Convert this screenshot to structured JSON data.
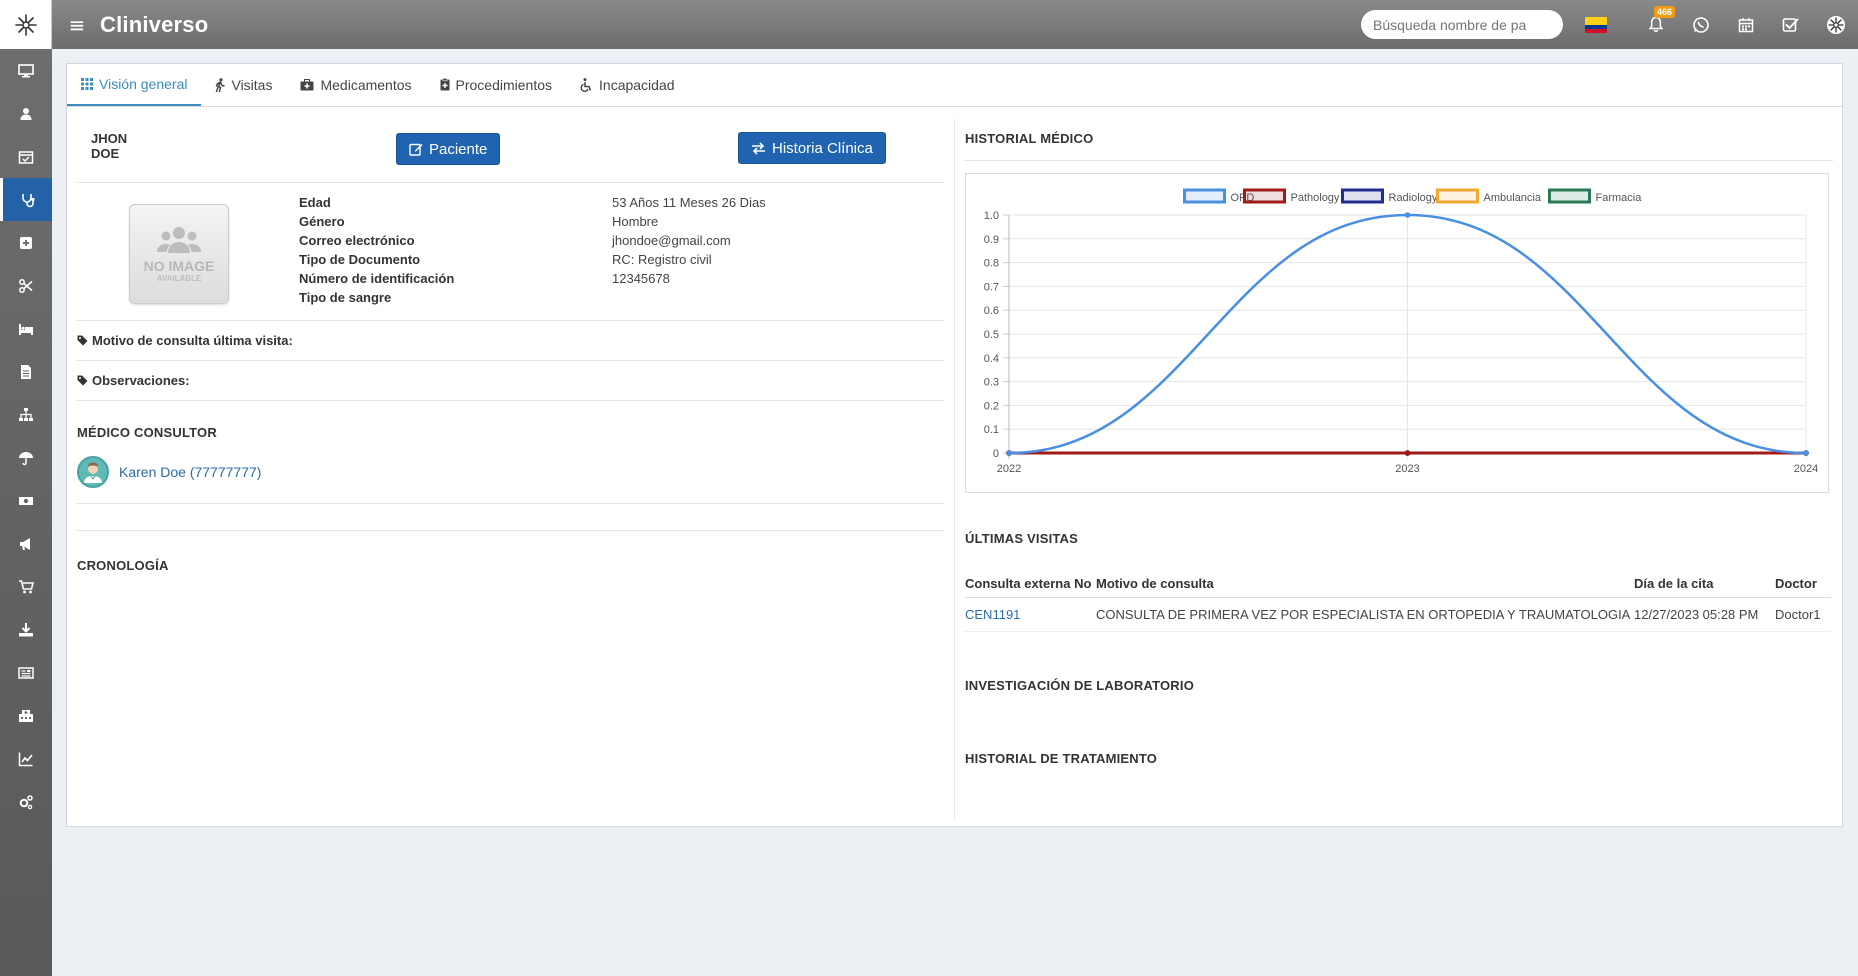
{
  "app": {
    "title": "Cliniverso"
  },
  "topbar": {
    "search_placeholder": "Búsqueda nombre de pa",
    "notification_count": "466"
  },
  "sidebar": {
    "items": [
      "desktop-icon",
      "user-icon",
      "calendar-check-icon",
      "stethoscope-icon",
      "plus-square-icon",
      "scissors-icon",
      "bed-icon",
      "file-icon",
      "sitemap-icon",
      "umbrella-icon",
      "money-icon",
      "bullhorn-icon",
      "cart-icon",
      "download-icon",
      "newspaper-icon",
      "hospital-icon",
      "chart-icon",
      "cogs-icon"
    ],
    "active_index": 3
  },
  "tabs": [
    {
      "label": "Visión general",
      "icon": "th-icon"
    },
    {
      "label": "Visitas",
      "icon": "walking-icon"
    },
    {
      "label": "Medicamentos",
      "icon": "briefcase-medical-icon"
    },
    {
      "label": "Procedimientos",
      "icon": "clipboard-icon"
    },
    {
      "label": "Incapacidad",
      "icon": "wheelchair-icon"
    }
  ],
  "patient": {
    "first_name": "JHON",
    "last_name": "DOE",
    "btn_paciente": "Paciente",
    "btn_historia": "Historia Clínica",
    "noimage_line1": "NO IMAGE",
    "noimage_line2": "AVAILABLE",
    "fields": [
      {
        "label": "Edad",
        "value": "53 Años 11 Meses 26 Dias"
      },
      {
        "label": "Género",
        "value": "Hombre"
      },
      {
        "label": "Correo electrónico",
        "value": "jhondoe@gmail.com"
      },
      {
        "label": "Tipo de Documento",
        "value": "RC: Registro civil"
      },
      {
        "label": "Número de identificación",
        "value": "12345678"
      },
      {
        "label": "Tipo de sangre",
        "value": ""
      }
    ],
    "motivo_label": "Motivo de consulta última visita:",
    "observaciones_label": "Observaciones:"
  },
  "medico": {
    "title": "MÉDICO CONSULTOR",
    "doctor": "Karen Doe (77777777)"
  },
  "cronologia": {
    "title": "CRONOLOGÍA"
  },
  "historial": {
    "title": "HISTORIAL MÉDICO"
  },
  "chart_data": {
    "type": "line",
    "title": "",
    "x": [
      "2022",
      "2023",
      "2024"
    ],
    "series": [
      {
        "name": "OPD",
        "values": [
          0,
          1,
          0
        ],
        "color": "#4a90e2"
      },
      {
        "name": "Pathology",
        "values": [
          0,
          0,
          0
        ],
        "color": "#a11a1a"
      },
      {
        "name": "Radiology",
        "values": [
          0,
          0,
          0
        ],
        "color": "#1f2f8f"
      },
      {
        "name": "Ambulancia",
        "values": [
          0,
          0,
          0
        ],
        "color": "#f0a830"
      },
      {
        "name": "Farmacia",
        "values": [
          0,
          0,
          0
        ],
        "color": "#2a7a55"
      }
    ],
    "yticks": [
      "0",
      "0.1",
      "0.2",
      "0.3",
      "0.4",
      "0.5",
      "0.6",
      "0.7",
      "0.8",
      "0.9",
      "1.0"
    ],
    "ylim": [
      0,
      1
    ],
    "grid": true,
    "legend": "top"
  },
  "visitas": {
    "title": "ÚLTIMAS VISITAS",
    "columns": [
      "Consulta externa No",
      "Motivo de consulta",
      "Día de la cita",
      "Doctor"
    ],
    "rows": [
      [
        "CEN1191",
        "CONSULTA DE PRIMERA VEZ POR ESPECIALISTA EN ORTOPEDIA Y TRAUMATOLOGIA",
        "12/27/2023 05:28 PM",
        "Doctor1"
      ]
    ]
  },
  "laboratorio": {
    "title": "INVESTIGACIÓN DE LABORATORIO"
  },
  "tratamiento": {
    "title": "HISTORIAL DE TRATAMIENTO"
  }
}
